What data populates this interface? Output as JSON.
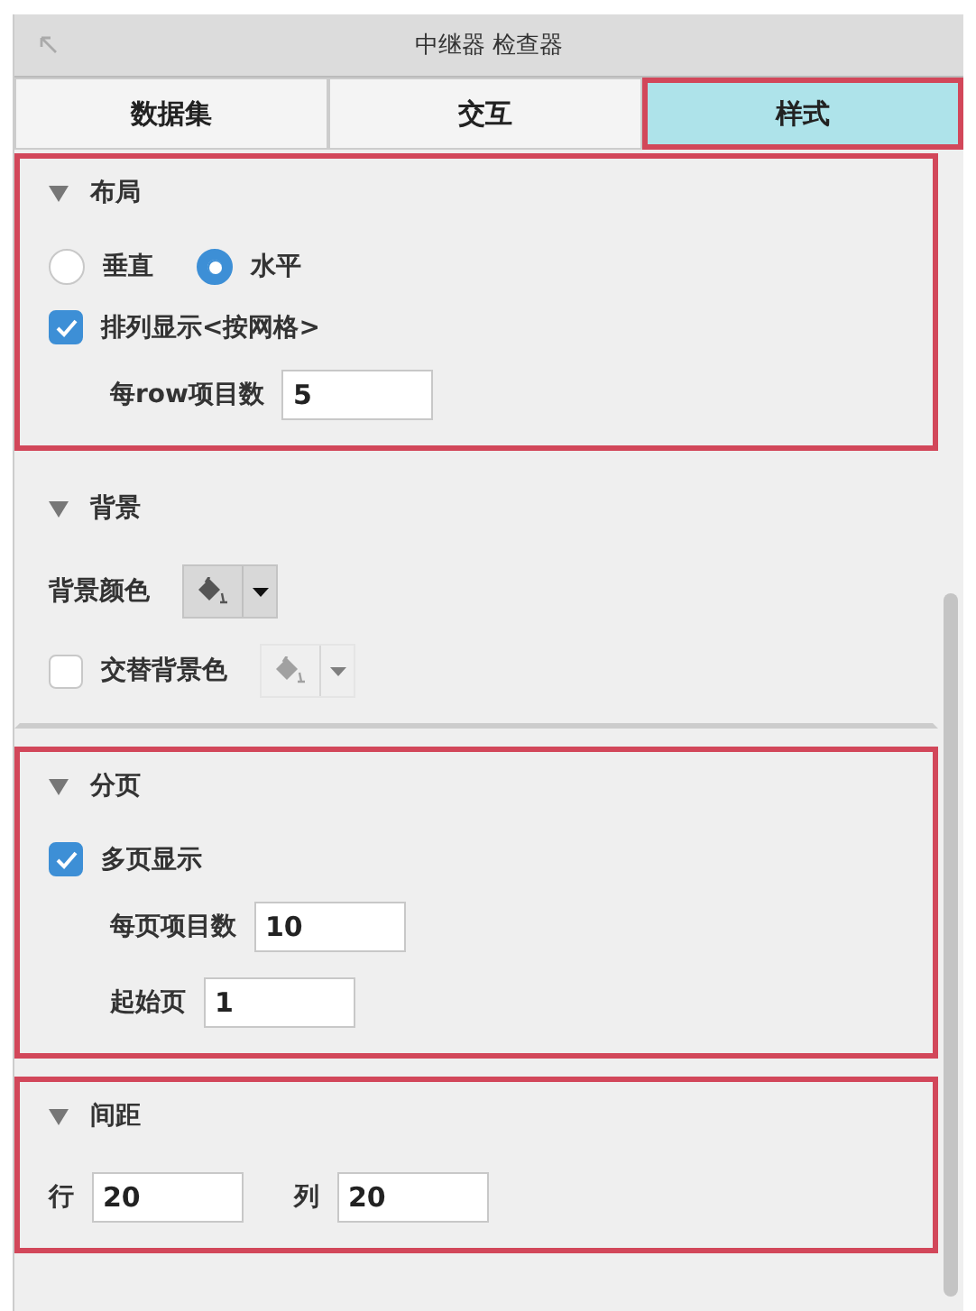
{
  "window": {
    "title": "中继器 检查器"
  },
  "tabs": [
    {
      "label": "数据集",
      "selected": false,
      "highlighted": false
    },
    {
      "label": "交互",
      "selected": false,
      "highlighted": false
    },
    {
      "label": "样式",
      "selected": true,
      "highlighted": true
    }
  ],
  "sections": [
    {
      "title": "布局",
      "expanded": true,
      "highlighted": true,
      "rows": [
        {
          "kind": "radios",
          "options": [
            {
              "label": "垂直",
              "selected": false
            },
            {
              "label": "水平",
              "selected": true
            }
          ]
        },
        {
          "kind": "checkbox",
          "label": "排列显示<按网格>",
          "checked": true
        },
        {
          "kind": "fields",
          "indented": true,
          "fields": [
            {
              "label": "每row项目数",
              "value": "5"
            }
          ]
        }
      ]
    },
    {
      "title": "背景",
      "expanded": true,
      "highlighted": false,
      "rows": [
        {
          "kind": "color",
          "label": "背景颜色",
          "disabled": false
        },
        {
          "kind": "color-check",
          "label": "交替背景色",
          "checked": false,
          "disabled": true
        }
      ]
    },
    {
      "title": "分页",
      "expanded": true,
      "highlighted": true,
      "rows": [
        {
          "kind": "checkbox",
          "label": "多页显示",
          "checked": true
        },
        {
          "kind": "fields",
          "indented": true,
          "fields": [
            {
              "label": "每页项目数",
              "value": "10"
            }
          ]
        },
        {
          "kind": "fields",
          "indented": true,
          "fields": [
            {
              "label": "起始页",
              "value": "1"
            }
          ]
        }
      ]
    },
    {
      "title": "间距",
      "expanded": true,
      "highlighted": true,
      "rows": [
        {
          "kind": "fields",
          "indented": false,
          "fields": [
            {
              "label": "行",
              "value": "20"
            },
            {
              "label": "列",
              "value": "20"
            }
          ]
        }
      ]
    }
  ]
}
